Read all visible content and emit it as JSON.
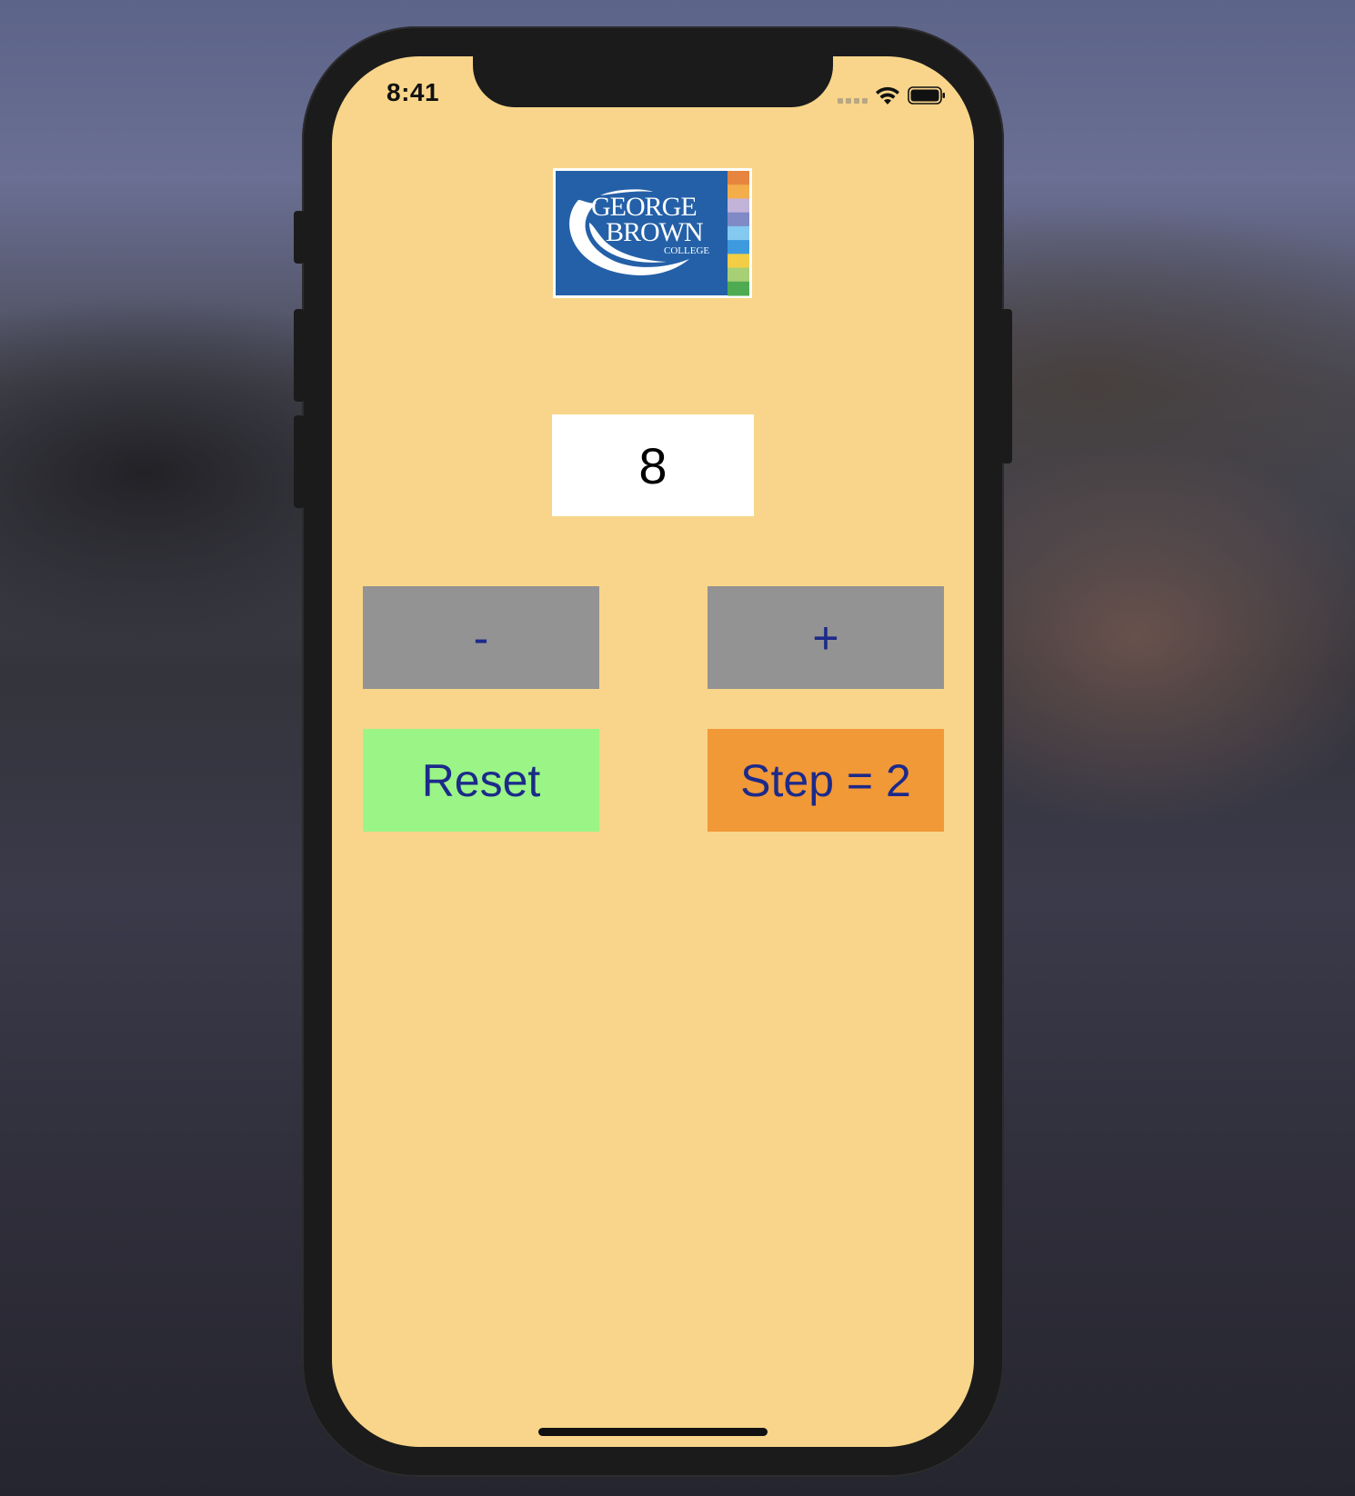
{
  "status_bar": {
    "time": "8:41",
    "icons": [
      "cellular-signal-icon",
      "wifi-icon",
      "battery-icon"
    ]
  },
  "logo": {
    "line1": "GEORGE",
    "line2": "BROWN",
    "line3": "COLLEGE",
    "colors": {
      "field": "#2460a7",
      "stripes": [
        "#e7853f",
        "#f3ae4b",
        "#c2b3d9",
        "#7f8ac6",
        "#84c9f0",
        "#3d9ade",
        "#f2cd45",
        "#a7cf74",
        "#4eab52"
      ]
    }
  },
  "counter": {
    "value": "8"
  },
  "buttons": {
    "decrement_label": "-",
    "increment_label": "+",
    "reset_label": "Reset",
    "step_label": "Step = 2"
  },
  "colors": {
    "screen_background": "#f8d58a",
    "stepper_buttons": "#939393",
    "reset_button": "#9af586",
    "step_button": "#f19837",
    "button_text": "#1c2a8a"
  }
}
